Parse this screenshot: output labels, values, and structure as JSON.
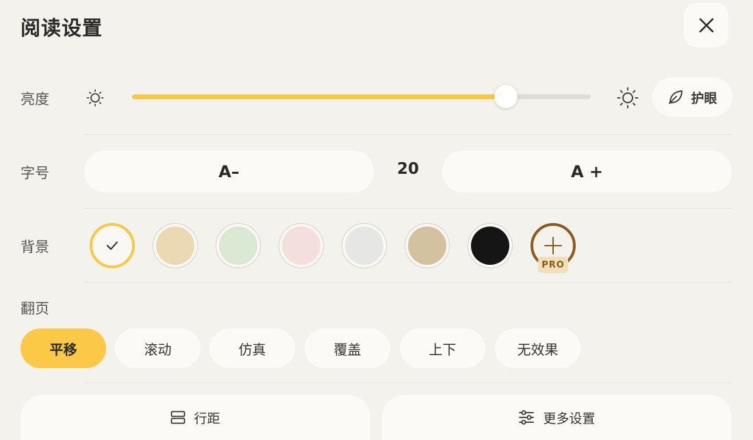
{
  "header": {
    "title": "阅读设置",
    "close_icon": "close-icon"
  },
  "brightness": {
    "label": "亮度",
    "level_percent": 81.5,
    "accent_color": "#f7c843",
    "eye_care_label": "护眼",
    "eye_care_icon": "leaf-icon"
  },
  "font_size": {
    "label": "字号",
    "decrease_label": "A–",
    "value": "20",
    "increase_label": "A +"
  },
  "background": {
    "label": "背景",
    "swatches": [
      {
        "name": "default",
        "color": "#f9f8f4",
        "selected": true
      },
      {
        "name": "beige",
        "color": "#ead9b3"
      },
      {
        "name": "green",
        "color": "#dbe8d4"
      },
      {
        "name": "pink",
        "color": "#f3dfdc"
      },
      {
        "name": "gray",
        "color": "#e6e6e4"
      },
      {
        "name": "tan",
        "color": "#d4c1a0"
      },
      {
        "name": "black",
        "color": "#151515"
      }
    ],
    "pro_badge": "PRO",
    "pro_color": "#8a5a1e"
  },
  "page_turn": {
    "label": "翻页",
    "options": [
      "平移",
      "滚动",
      "仿真",
      "覆盖",
      "上下",
      "无效果"
    ],
    "active_index": 0
  },
  "bottom": {
    "line_spacing_label": "行距",
    "line_spacing_icon": "line-spacing-icon",
    "more_settings_label": "更多设置",
    "more_settings_icon": "sliders-icon"
  }
}
